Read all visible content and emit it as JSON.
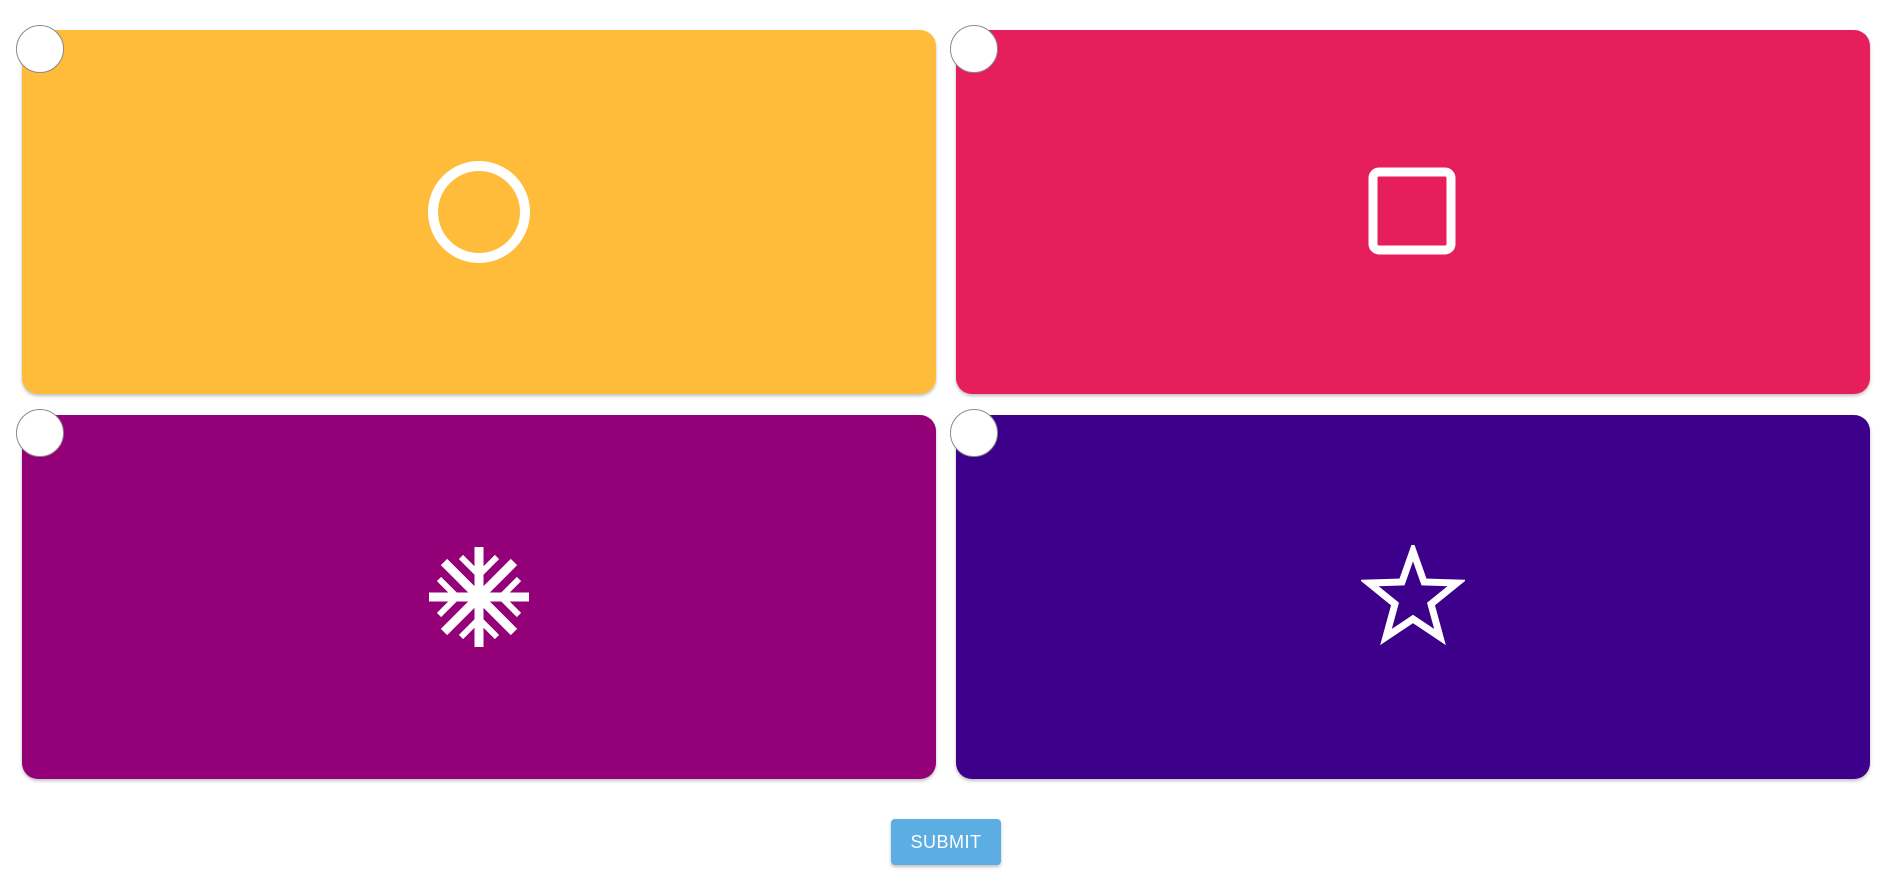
{
  "options": [
    {
      "shape": "circle-icon",
      "color": "#FFBC3B"
    },
    {
      "shape": "square-icon",
      "color": "#E71E5C"
    },
    {
      "shape": "snowflake-icon",
      "color": "#930077"
    },
    {
      "shape": "star-icon",
      "color": "#3C008A"
    }
  ],
  "submit": {
    "label": "SUBMIT",
    "color": "#5CADE2"
  }
}
